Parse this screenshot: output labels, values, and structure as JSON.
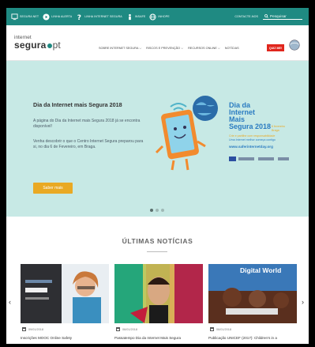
{
  "topbar": {
    "items": [
      {
        "label": "SEGURA NET",
        "icon": "shield-screen-icon"
      },
      {
        "label": "LINHA ALERTA",
        "icon": "play-circle-icon"
      },
      {
        "label": "LINHA INTERNET SEGURA",
        "icon": "question-icon"
      },
      {
        "label": "INSAFE",
        "icon": "people-icon"
      },
      {
        "label": "INHOPE",
        "icon": "globe-icon"
      }
    ],
    "contact": "CONTACTE-NOS",
    "search_label": "Pesquisar"
  },
  "header": {
    "logo_line1": "internet",
    "logo_line2a": "segura",
    "logo_line2b": "pt",
    "nav": [
      "SOBRE INTERNET SEGURA ⌵",
      "RISCOS E PREVENÇÃO ⌵",
      "RECURSOS ONLINE ⌵",
      "NOTÍCIAS"
    ],
    "quiz": "QUIZ ME!"
  },
  "hero": {
    "title": "Dia da Internet mais Segura 2018",
    "p1": "A página do Dia da Internet mais Segura 2018 já se encontra disponível!",
    "p2": "Venha descobrir o que o Centro Internet Segura preparou para si, no dia 6 de Fevereiro, em Braga.",
    "button": "Saber mais",
    "poster_l1": "Dia da",
    "poster_l2": "Internet",
    "poster_l3": "Mais",
    "poster_l4": "Segura 2018",
    "poster_date": "6 fevereiro",
    "poster_place": "Braga",
    "poster_sub": "Crie e partilhe com responsabilidade",
    "poster_sub2": "Uma Internet melhor começa contigo",
    "poster_url": "www.saferinternetday.org",
    "slide_index": 1,
    "slide_total": 3,
    "colors": {
      "hero_bg": "#c7e9e5",
      "button": "#e9a924",
      "topbar": "#1f8a82"
    }
  },
  "news": {
    "title": "ÚLTIMAS NOTÍCIAS",
    "cards": [
      {
        "date": "09/01/2018",
        "title": "Inscrições MOOC Online Safety"
      },
      {
        "date": "06/01/2018",
        "title": "Passatempo Dia da Internet Mais Segura"
      },
      {
        "date": "06/01/2018",
        "title": "Publicação UNICEF (2017): Children's in a"
      }
    ],
    "card3_overlay": "Digital World"
  }
}
